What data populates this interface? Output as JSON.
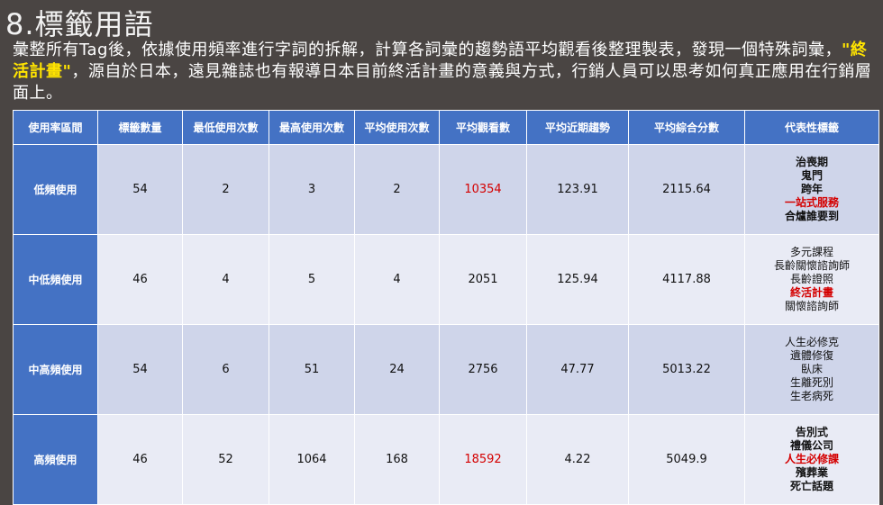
{
  "title": "8.標籤用語",
  "intro": {
    "before": "彙整所有Tag後，依據使用頻率進行字詞的拆解，計算各詞彙的趨勢語平均觀看後整理製表，發現一個特殊詞彙，",
    "highlight": "\"終活計畫\"",
    "after": "，源自於日本，遠見雜誌也有報導日本目前終活計畫的意義與方式，行銷人員可以思考如何真正應用在行銷層面上。"
  },
  "table": {
    "headers": [
      "使用率區間",
      "標籤數量",
      "最低使用次數",
      "最高使用次數",
      "平均使用次數",
      "平均觀看數",
      "平均近期趨勢",
      "平均綜合分數",
      "代表性標籤"
    ],
    "rows": [
      {
        "band": "低頻使用",
        "count": "54",
        "min": "2",
        "max": "3",
        "avg": "2",
        "views": "10354",
        "views_highlight": true,
        "trend": "123.91",
        "score": "2115.64",
        "tags": [
          "治喪期",
          "鬼門",
          "跨年",
          "一站式服務",
          "合爐誰要到"
        ],
        "tag_highlight_index": 3,
        "tags_bold": true
      },
      {
        "band": "中低頻使用",
        "count": "46",
        "min": "4",
        "max": "5",
        "avg": "4",
        "views": "2051",
        "views_highlight": false,
        "trend": "125.94",
        "score": "4117.88",
        "tags": [
          "多元課程",
          "長齡關懷諮詢師",
          "長齡證照",
          "終活計畫",
          "關懷諮詢師"
        ],
        "tag_highlight_index": 3,
        "tags_bold": false
      },
      {
        "band": "中高頻使用",
        "count": "54",
        "min": "6",
        "max": "51",
        "avg": "24",
        "views": "2756",
        "views_highlight": false,
        "trend": "47.77",
        "score": "5013.22",
        "tags": [
          "人生必修克",
          "遺體修復",
          "臥床",
          "生離死別",
          "生老病死"
        ],
        "tag_highlight_index": -1,
        "tags_bold": false
      },
      {
        "band": "高頻使用",
        "count": "46",
        "min": "52",
        "max": "1064",
        "avg": "168",
        "views": "18592",
        "views_highlight": true,
        "trend": "4.22",
        "score": "5049.9",
        "tags": [
          "告別式",
          "禮儀公司",
          "人生必修課",
          "殯葬業",
          "死亡話題"
        ],
        "tag_highlight_index": 2,
        "tags_bold": true
      }
    ]
  },
  "colors": {
    "header_bg": "#4472c4",
    "highlight_red": "#d40000",
    "highlight_yellow": "#ffe400"
  }
}
